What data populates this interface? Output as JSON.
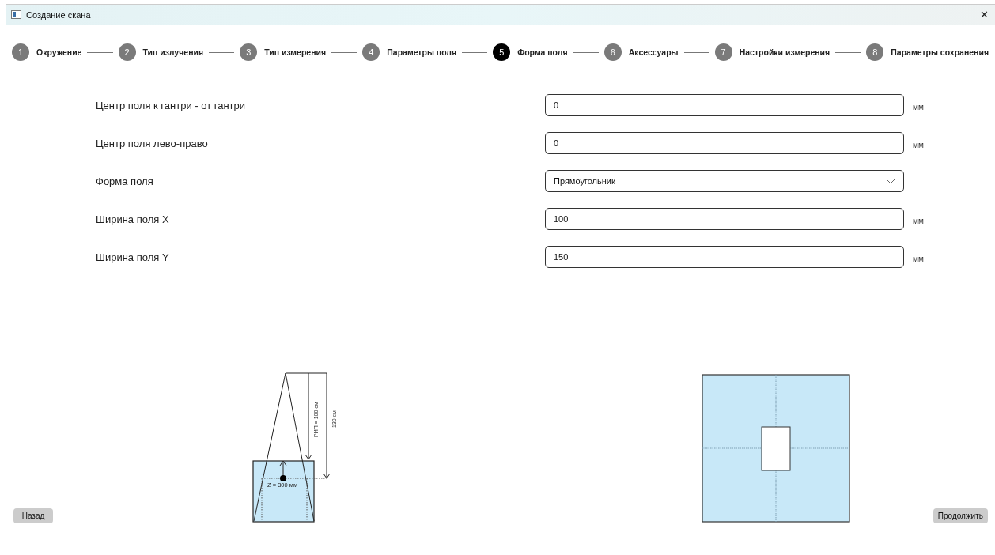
{
  "window": {
    "title": "Создание скана",
    "close": "✕"
  },
  "steps": [
    {
      "number": "1",
      "label": "Окружение",
      "selected": false
    },
    {
      "number": "2",
      "label": "Тип излучения",
      "selected": false
    },
    {
      "number": "3",
      "label": "Тип измерения",
      "selected": false
    },
    {
      "number": "4",
      "label": "Параметры поля",
      "selected": false
    },
    {
      "number": "5",
      "label": "Форма поля",
      "selected": true
    },
    {
      "number": "6",
      "label": "Аксессуары",
      "selected": false
    },
    {
      "number": "7",
      "label": "Настройки измерения",
      "selected": false
    },
    {
      "number": "8",
      "label": "Параметры сохранения",
      "selected": false
    }
  ],
  "fields": [
    {
      "kind": "text",
      "label": "Центр поля к гантри - от гантри",
      "value": "0",
      "unit": "мм"
    },
    {
      "kind": "text",
      "label": "Центр поля лево-право",
      "value": "0",
      "unit": "мм"
    },
    {
      "kind": "dropdown",
      "label": "Форма поля",
      "value": "Прямоугольник"
    },
    {
      "kind": "text",
      "label": "Ширина поля X",
      "value": "100",
      "unit": "мм"
    },
    {
      "kind": "text",
      "label": "Ширина поля Y",
      "value": "150",
      "unit": "мм"
    }
  ],
  "setup_diagram": {
    "ssd_label": "РИП = 100 см",
    "distance_label": "130 см",
    "depth_label": "Z = 300 мм"
  },
  "buttons": {
    "back": "Назад",
    "next": "Продолжить"
  }
}
